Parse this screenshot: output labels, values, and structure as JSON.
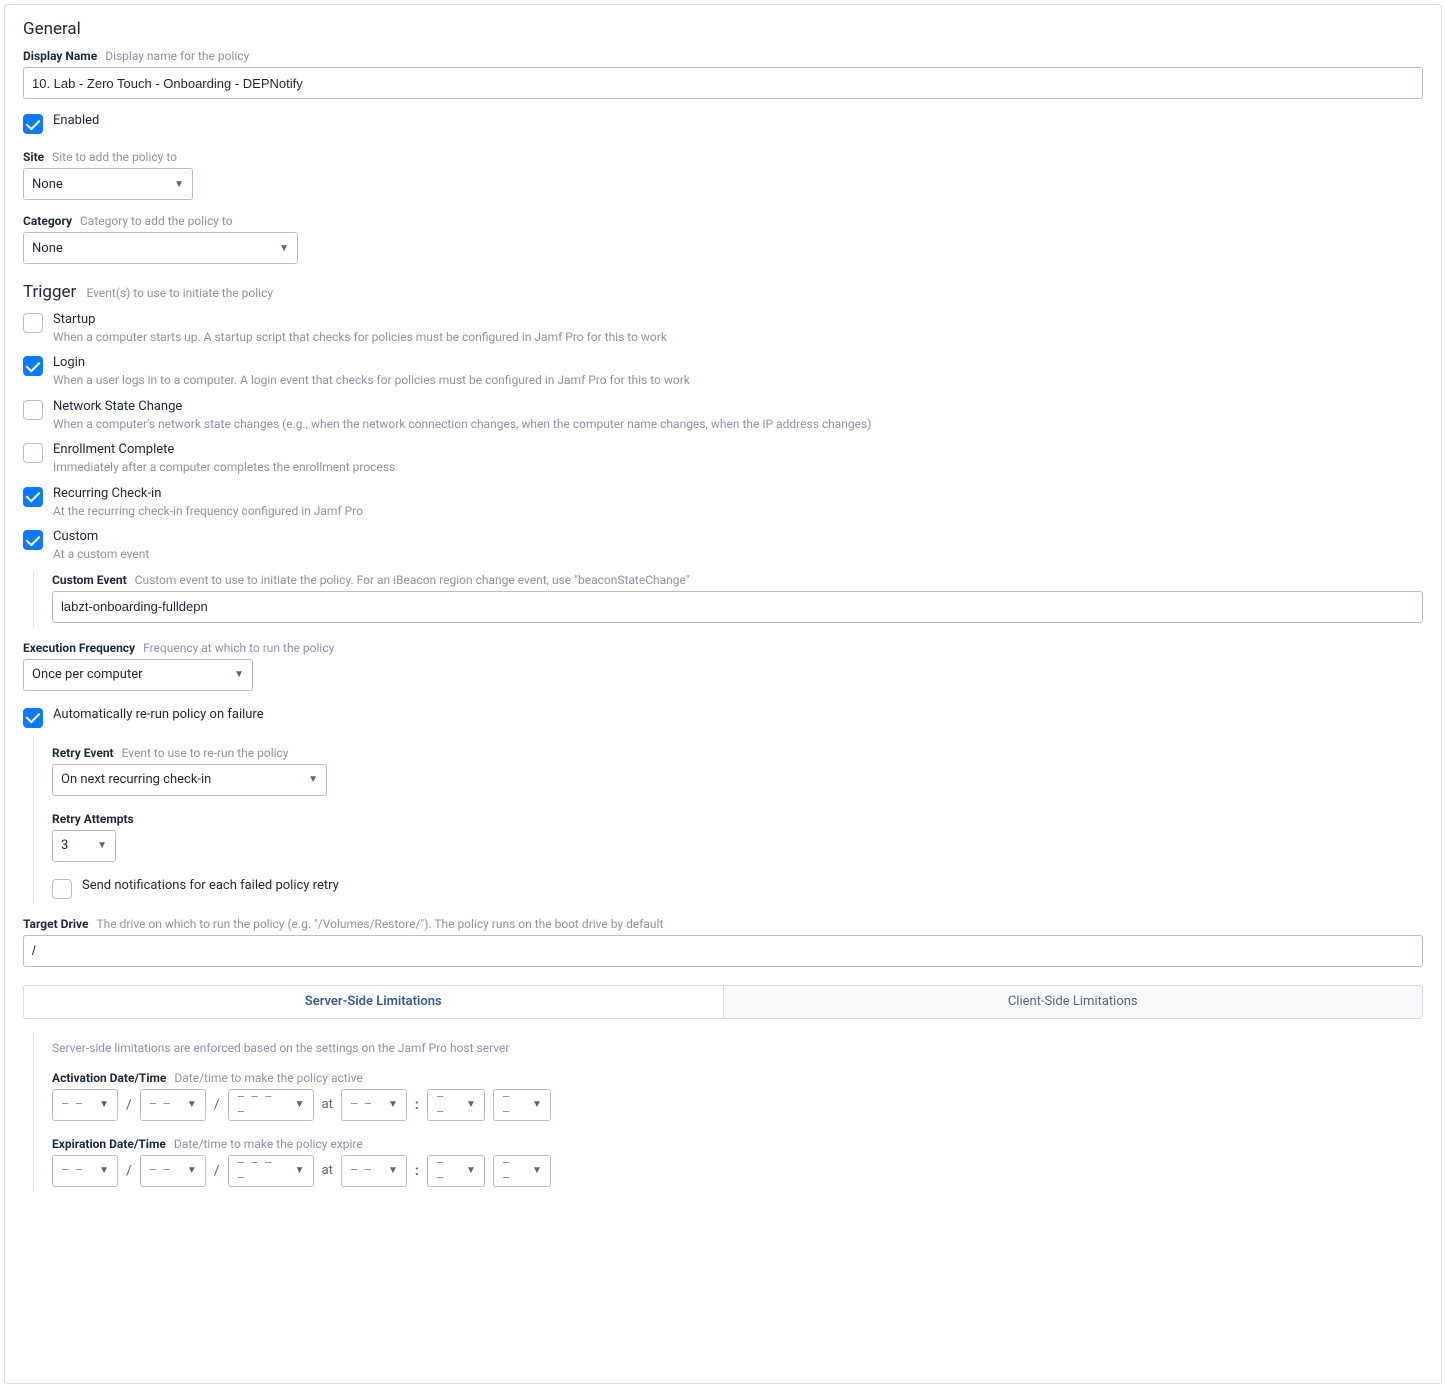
{
  "section": {
    "general": "General"
  },
  "displayName": {
    "label": "Display Name",
    "hint": "Display name for the policy",
    "value": "10. Lab - Zero Touch - Onboarding - DEPNotify"
  },
  "enabled": {
    "label": "Enabled",
    "checked": true
  },
  "site": {
    "label": "Site",
    "hint": "Site to add the policy to",
    "value": "None"
  },
  "category": {
    "label": "Category",
    "hint": "Category to add the policy to",
    "value": "None"
  },
  "trigger": {
    "title": "Trigger",
    "hint": "Event(s) to use to initiate the policy",
    "items": [
      {
        "key": "startup",
        "label": "Startup",
        "desc": "When a computer starts up. A startup script that checks for policies must be configured in Jamf Pro for this to work",
        "checked": false
      },
      {
        "key": "login",
        "label": "Login",
        "desc": "When a user logs in to a computer. A login event that checks for policies must be configured in Jamf Pro for this to work",
        "checked": true
      },
      {
        "key": "network",
        "label": "Network State Change",
        "desc": "When a computer's network state changes (e.g., when the network connection changes, when the computer name changes, when the IP address changes)",
        "checked": false
      },
      {
        "key": "enroll",
        "label": "Enrollment Complete",
        "desc": "Immediately after a computer completes the enrollment process",
        "checked": false
      },
      {
        "key": "recur",
        "label": "Recurring Check-in",
        "desc": "At the recurring check-in frequency configured in Jamf Pro",
        "checked": true
      },
      {
        "key": "custom",
        "label": "Custom",
        "desc": "At a custom event",
        "checked": true
      }
    ],
    "customEvent": {
      "label": "Custom Event",
      "hint": "Custom event to use to initiate the policy. For an iBeacon region change event, use \"beaconStateChange\"",
      "value": "labzt-onboarding-fulldepn"
    }
  },
  "executionFrequency": {
    "label": "Execution Frequency",
    "hint": "Frequency at which to run the policy",
    "value": "Once per computer"
  },
  "autoRerun": {
    "label": "Automatically re-run policy on failure",
    "checked": true,
    "retryEvent": {
      "label": "Retry Event",
      "hint": "Event to use to re-run the policy",
      "value": "On next recurring check-in"
    },
    "retryAttempts": {
      "label": "Retry Attempts",
      "value": "3"
    },
    "notify": {
      "label": "Send notifications for each failed policy retry",
      "checked": false
    }
  },
  "targetDrive": {
    "label": "Target Drive",
    "hint": "The drive on which to run the policy (e.g. \"/Volumes/Restore/\"). The policy runs on the boot drive by default",
    "value": "/"
  },
  "limitations": {
    "tabs": {
      "server": "Server-Side Limitations",
      "client": "Client-Side Limitations"
    },
    "serverDesc": "Server-side limitations are enforced based on the settings on the Jamf Pro host server",
    "activation": {
      "label": "Activation Date/Time",
      "hint": "Date/time to make the policy active"
    },
    "expiration": {
      "label": "Expiration Date/Time",
      "hint": "Date/time to make the policy expire"
    },
    "atLabel": "at",
    "dateSep": "/",
    "timeSep": ":",
    "placeholders": {
      "d2": "– –",
      "d4": "– – – –"
    }
  }
}
